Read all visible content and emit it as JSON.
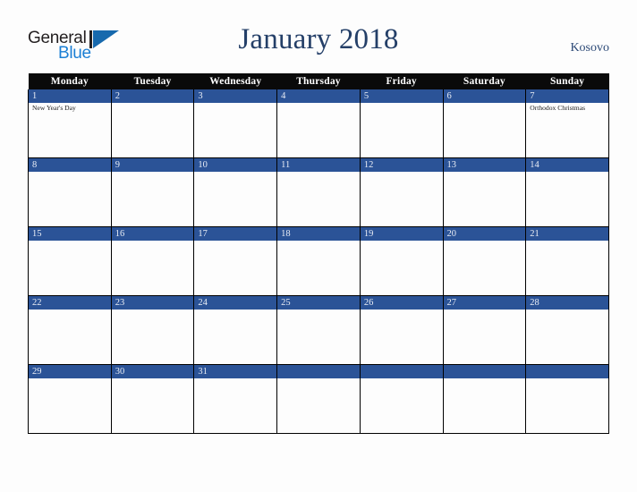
{
  "brand": {
    "name_part1": "General",
    "name_part2": "Blue",
    "mark": "triangle-mark"
  },
  "header": {
    "title": "January 2018",
    "country": "Kosovo"
  },
  "colors": {
    "date_bar_blue": "#2b5397",
    "header_black": "#0a0a0a",
    "title_navy": "#243f68",
    "brand_blue": "#1b7fd4",
    "page_background": "#fdfdfd"
  },
  "calendar": {
    "weekdays": [
      "Monday",
      "Tuesday",
      "Wednesday",
      "Thursday",
      "Friday",
      "Saturday",
      "Sunday"
    ],
    "weeks": [
      [
        {
          "date": "1",
          "events": [
            "New Year's Day"
          ]
        },
        {
          "date": "2",
          "events": []
        },
        {
          "date": "3",
          "events": []
        },
        {
          "date": "4",
          "events": []
        },
        {
          "date": "5",
          "events": []
        },
        {
          "date": "6",
          "events": []
        },
        {
          "date": "7",
          "events": [
            "Orthodox Christmas"
          ]
        }
      ],
      [
        {
          "date": "8",
          "events": []
        },
        {
          "date": "9",
          "events": []
        },
        {
          "date": "10",
          "events": []
        },
        {
          "date": "11",
          "events": []
        },
        {
          "date": "12",
          "events": []
        },
        {
          "date": "13",
          "events": []
        },
        {
          "date": "14",
          "events": []
        }
      ],
      [
        {
          "date": "15",
          "events": []
        },
        {
          "date": "16",
          "events": []
        },
        {
          "date": "17",
          "events": []
        },
        {
          "date": "18",
          "events": []
        },
        {
          "date": "19",
          "events": []
        },
        {
          "date": "20",
          "events": []
        },
        {
          "date": "21",
          "events": []
        }
      ],
      [
        {
          "date": "22",
          "events": []
        },
        {
          "date": "23",
          "events": []
        },
        {
          "date": "24",
          "events": []
        },
        {
          "date": "25",
          "events": []
        },
        {
          "date": "26",
          "events": []
        },
        {
          "date": "27",
          "events": []
        },
        {
          "date": "28",
          "events": []
        }
      ],
      [
        {
          "date": "29",
          "events": []
        },
        {
          "date": "30",
          "events": []
        },
        {
          "date": "31",
          "events": []
        },
        {
          "date": "",
          "events": []
        },
        {
          "date": "",
          "events": []
        },
        {
          "date": "",
          "events": []
        },
        {
          "date": "",
          "events": []
        }
      ]
    ]
  }
}
